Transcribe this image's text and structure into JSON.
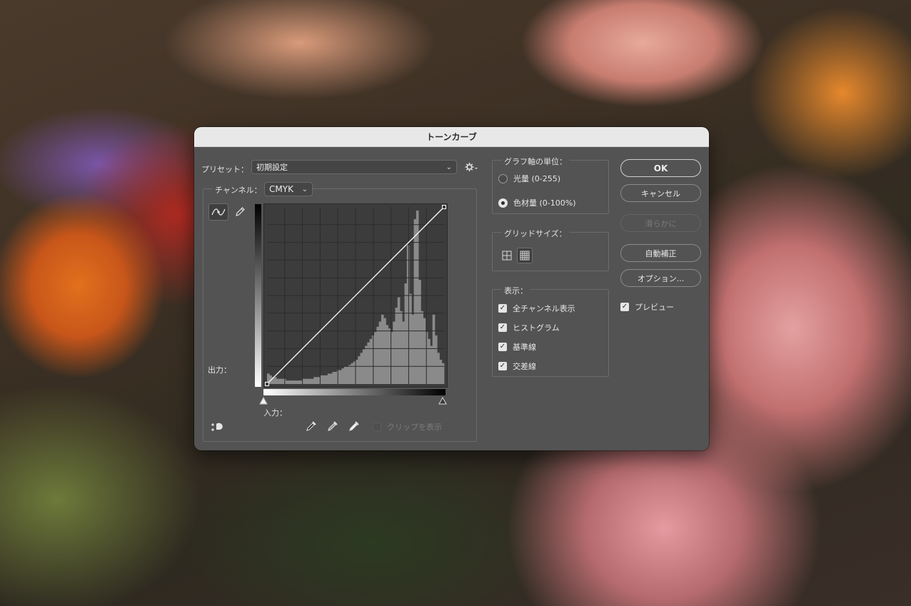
{
  "dialog": {
    "title": "トーンカーブ",
    "preset_label": "プリセット：",
    "preset_value": "初期設定",
    "channel_label": "チャンネル：",
    "channel_value": "CMYK",
    "output_label": "出力：",
    "input_label": "入力：",
    "clip_label": "クリップを表示",
    "graph_units": {
      "title": "グラフ軸の単位：",
      "options": [
        "光量 (0-255)",
        "色材量 (0-100%)"
      ],
      "selected": "色材量 (0-100%)"
    },
    "grid_size": {
      "title": "グリッドサイズ：",
      "selected": "fine-grid"
    },
    "display": {
      "title": "表示：",
      "options": [
        {
          "label": "全チャンネル表示",
          "checked": true
        },
        {
          "label": "ヒストグラム",
          "checked": true
        },
        {
          "label": "基準線",
          "checked": true
        },
        {
          "label": "交差線",
          "checked": true
        }
      ]
    },
    "buttons": {
      "ok": "OK",
      "cancel": "キャンセル",
      "smooth": "滑らかに",
      "auto": "自動補正",
      "options": "オプション..."
    },
    "preview": {
      "label": "プレビュー",
      "checked": true
    },
    "tools": [
      "curve-point-icon",
      "pencil-icon"
    ],
    "eyedroppers": [
      "black-point-eyedropper-icon",
      "gray-point-eyedropper-icon",
      "white-point-eyedropper-icon"
    ],
    "colors": {
      "panel": "#535353",
      "graph_bg": "#3c3c3c",
      "histogram": "#8a8a8a",
      "curve": "#ffffff"
    }
  },
  "curve": {
    "points": [
      [
        0,
        0
      ],
      [
        100,
        100
      ]
    ]
  },
  "histogram": [
    6,
    5,
    4,
    4,
    3,
    3,
    3,
    3,
    2,
    2,
    2,
    2,
    2,
    2,
    2,
    3,
    3,
    3,
    3,
    3,
    4,
    4,
    4,
    5,
    5,
    5,
    6,
    6,
    7,
    7,
    8,
    8,
    9,
    10,
    10,
    11,
    12,
    13,
    14,
    16,
    18,
    20,
    22,
    24,
    26,
    28,
    30,
    33,
    36,
    40,
    38,
    34,
    32,
    30,
    36,
    44,
    50,
    42,
    36,
    58,
    80,
    52,
    40,
    95,
    100,
    60,
    42,
    38,
    30,
    26,
    22,
    40,
    28,
    18,
    14,
    12
  ]
}
